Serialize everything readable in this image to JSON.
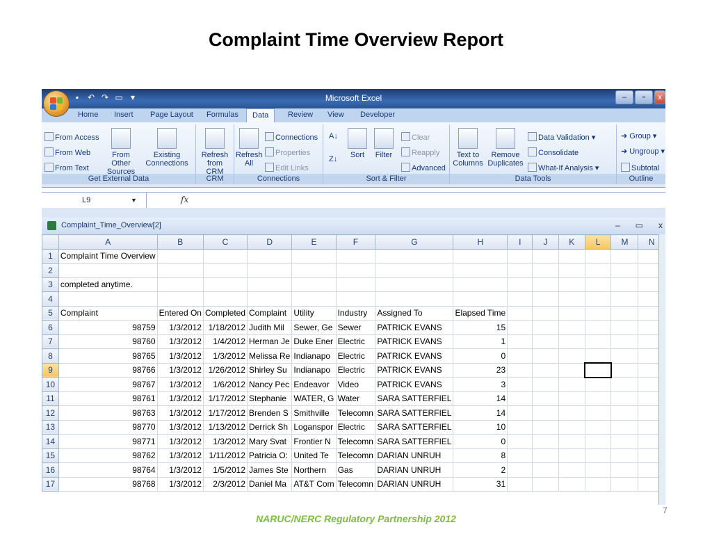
{
  "slide": {
    "title": "Complaint Time Overview Report",
    "footer": "NARUC/NERC Regulatory Partnership 2012",
    "page_number": "7"
  },
  "window": {
    "title": "Microsoft Excel",
    "doc_title": "Complaint_Time_Overview[2]"
  },
  "ribbon": {
    "tabs": [
      "Home",
      "Insert",
      "Page Layout",
      "Formulas",
      "Data",
      "Review",
      "View",
      "Developer"
    ],
    "active_tab": "Data",
    "get_external": {
      "label": "Get External Data",
      "from_access": "From Access",
      "from_web": "From Web",
      "from_text": "From Text",
      "from_other_1": "From Other",
      "from_other_2": "Sources",
      "existing_1": "Existing",
      "existing_2": "Connections"
    },
    "crm": {
      "label": "CRM",
      "refresh_1": "Refresh",
      "refresh_2": "from CRM"
    },
    "connections": {
      "label": "Connections",
      "refresh_1": "Refresh",
      "refresh_2": "All",
      "connections": "Connections",
      "properties": "Properties",
      "edit_links": "Edit Links"
    },
    "sort_filter": {
      "label": "Sort & Filter",
      "sort": "Sort",
      "filter": "Filter",
      "clear": "Clear",
      "reapply": "Reapply",
      "advanced": "Advanced"
    },
    "data_tools": {
      "label": "Data Tools",
      "text_to_1": "Text to",
      "text_to_2": "Columns",
      "remove_1": "Remove",
      "remove_2": "Duplicates",
      "data_validation": "Data Validation",
      "consolidate": "Consolidate",
      "what_if": "What-If Analysis"
    },
    "outline": {
      "label": "Outline",
      "group": "Group",
      "ungroup": "Ungroup",
      "subtotal": "Subtotal"
    }
  },
  "formula_bar": {
    "name_box": "L9",
    "fx": "fx",
    "content": ""
  },
  "sheet": {
    "columns": [
      "A",
      "B",
      "C",
      "D",
      "E",
      "F",
      "G",
      "H",
      "I",
      "J",
      "K",
      "L",
      "M",
      "N"
    ],
    "selected_col": "L",
    "selected_row": "9",
    "rows": [
      {
        "n": "1",
        "cells": [
          "Complaint Time Overview",
          "",
          "",
          "",
          "",
          "",
          "",
          "",
          "",
          "",
          "",
          "",
          "",
          ""
        ]
      },
      {
        "n": "2",
        "cells": [
          "",
          "",
          "",
          "",
          "",
          "",
          "",
          "",
          "",
          "",
          "",
          "",
          "",
          ""
        ]
      },
      {
        "n": "3",
        "cells": [
          "completed anytime.",
          "",
          "",
          "",
          "",
          "",
          "",
          "",
          "",
          "",
          "",
          "",
          "",
          ""
        ]
      },
      {
        "n": "4",
        "cells": [
          "",
          "",
          "",
          "",
          "",
          "",
          "",
          "",
          "",
          "",
          "",
          "",
          "",
          ""
        ]
      },
      {
        "n": "5",
        "cells": [
          "Complaint",
          "Entered On",
          "Completed",
          "Complaint",
          "Utility",
          "Industry",
          "Assigned To",
          "Elapsed Time",
          "",
          "",
          "",
          "",
          "",
          ""
        ]
      },
      {
        "n": "6",
        "cells": [
          "98759",
          "1/3/2012",
          "1/18/2012",
          "Judith Mil",
          "Sewer, Ge",
          "Sewer",
          "PATRICK EVANS",
          "15",
          "",
          "",
          "",
          "",
          "",
          ""
        ]
      },
      {
        "n": "7",
        "cells": [
          "98760",
          "1/3/2012",
          "1/4/2012",
          "Herman Je",
          "Duke Ener",
          "Electric",
          "PATRICK EVANS",
          "1",
          "",
          "",
          "",
          "",
          "",
          ""
        ]
      },
      {
        "n": "8",
        "cells": [
          "98765",
          "1/3/2012",
          "1/3/2012",
          "Melissa Re",
          "Indianapo",
          "Electric",
          "PATRICK EVANS",
          "0",
          "",
          "",
          "",
          "",
          "",
          ""
        ]
      },
      {
        "n": "9",
        "cells": [
          "98766",
          "1/3/2012",
          "1/26/2012",
          "Shirley Su",
          "Indianapo",
          "Electric",
          "PATRICK EVANS",
          "23",
          "",
          "",
          "",
          "",
          "",
          ""
        ]
      },
      {
        "n": "10",
        "cells": [
          "98767",
          "1/3/2012",
          "1/6/2012",
          "Nancy Pec",
          "Endeavor",
          "Video",
          "PATRICK EVANS",
          "3",
          "",
          "",
          "",
          "",
          "",
          ""
        ]
      },
      {
        "n": "11",
        "cells": [
          "98761",
          "1/3/2012",
          "1/17/2012",
          "Stephanie",
          "WATER, G",
          "Water",
          "SARA SATTERFIEL",
          "14",
          "",
          "",
          "",
          "",
          "",
          ""
        ]
      },
      {
        "n": "12",
        "cells": [
          "98763",
          "1/3/2012",
          "1/17/2012",
          "Brenden S",
          "Smithville",
          "Telecomn",
          "SARA SATTERFIEL",
          "14",
          "",
          "",
          "",
          "",
          "",
          ""
        ]
      },
      {
        "n": "13",
        "cells": [
          "98770",
          "1/3/2012",
          "1/13/2012",
          "Derrick Sh",
          "Loganspor",
          "Electric",
          "SARA SATTERFIEL",
          "10",
          "",
          "",
          "",
          "",
          "",
          ""
        ]
      },
      {
        "n": "14",
        "cells": [
          "98771",
          "1/3/2012",
          "1/3/2012",
          "Mary Svat",
          "Frontier N",
          "Telecomn",
          "SARA SATTERFIEL",
          "0",
          "",
          "",
          "",
          "",
          "",
          ""
        ]
      },
      {
        "n": "15",
        "cells": [
          "98762",
          "1/3/2012",
          "1/11/2012",
          "Patricia O:",
          "United Te",
          "Telecomn",
          "DARIAN UNRUH",
          "8",
          "",
          "",
          "",
          "",
          "",
          ""
        ]
      },
      {
        "n": "16",
        "cells": [
          "98764",
          "1/3/2012",
          "1/5/2012",
          "James Ste",
          "Northern",
          "Gas",
          "DARIAN UNRUH",
          "2",
          "",
          "",
          "",
          "",
          "",
          ""
        ]
      },
      {
        "n": "17",
        "cells": [
          "98768",
          "1/3/2012",
          "2/3/2012",
          "Daniel Ma",
          "AT&T Com",
          "Telecomn",
          "DARIAN UNRUH",
          "31",
          "",
          "",
          "",
          "",
          "",
          ""
        ]
      }
    ]
  }
}
